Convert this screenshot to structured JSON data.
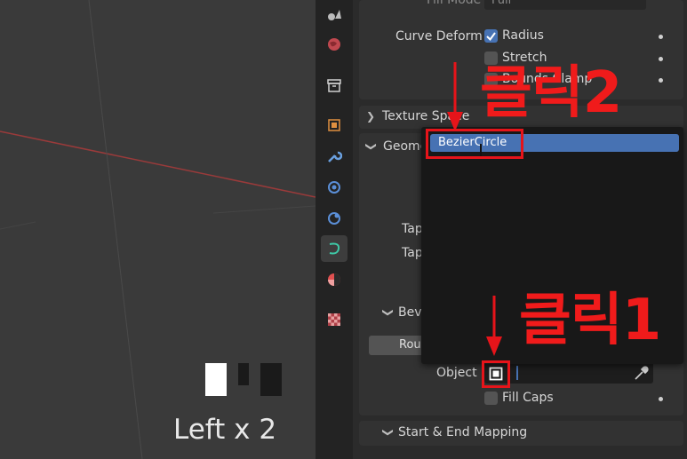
{
  "viewport": {
    "keycast": "Left x 2"
  },
  "properties": {
    "fill_mode_label": "Fill Mode",
    "fill_mode_value": "Full",
    "curve_deform_label": "Curve Deform",
    "radius_label": "Radius",
    "stretch_label": "Stretch",
    "bounds_clamp_label": "Bounds Clamp",
    "texture_space_label": "Texture Space",
    "geometry_label": "Geometry",
    "taper_label_1": "Tap",
    "taper_label_2": "Tap",
    "bevel_label": "Beve",
    "round_label": "Rou",
    "object_label": "Object",
    "fill_caps_label": "Fill Caps",
    "start_end_mapping_label": "Start & End Mapping"
  },
  "dropdown": {
    "item": "BezierCircle"
  },
  "annotations": {
    "click2": "클릭2",
    "click1": "클릭1"
  },
  "colors": {
    "accent": "#4772b3",
    "annotation_red": "#e6141a",
    "curve_tab": "#3ec9a7"
  }
}
